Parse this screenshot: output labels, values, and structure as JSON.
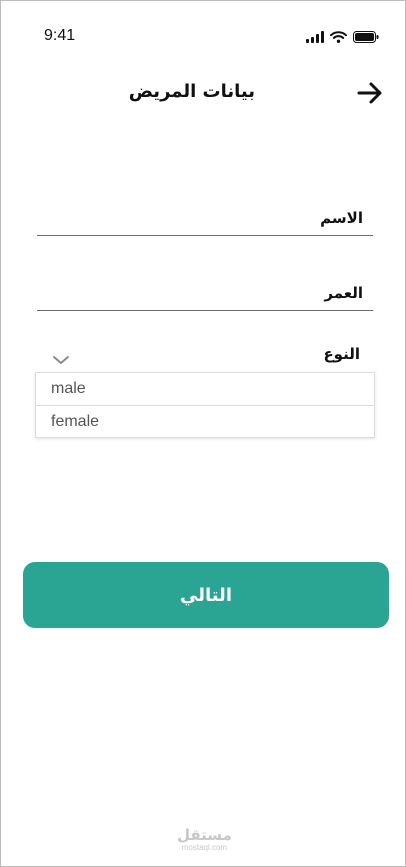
{
  "status_bar": {
    "time": "9:41",
    "icons": [
      "cellular-signal-icon",
      "wifi-icon",
      "battery-icon"
    ]
  },
  "header": {
    "title": "بيانات المريض",
    "back_icon": "arrow-right-icon"
  },
  "form": {
    "name": {
      "label": "الاسم",
      "value": ""
    },
    "age": {
      "label": "العمر",
      "value": ""
    },
    "gender": {
      "label": "النوع",
      "chevron_icon": "chevron-down-icon",
      "options": [
        "male",
        "female"
      ]
    }
  },
  "next_button": {
    "label": "التالي"
  },
  "watermark": {
    "arabic": "مستقل",
    "latin": "mostaql.com"
  },
  "colors": {
    "accent": "#2aa594",
    "line": "#6b6b6b"
  }
}
